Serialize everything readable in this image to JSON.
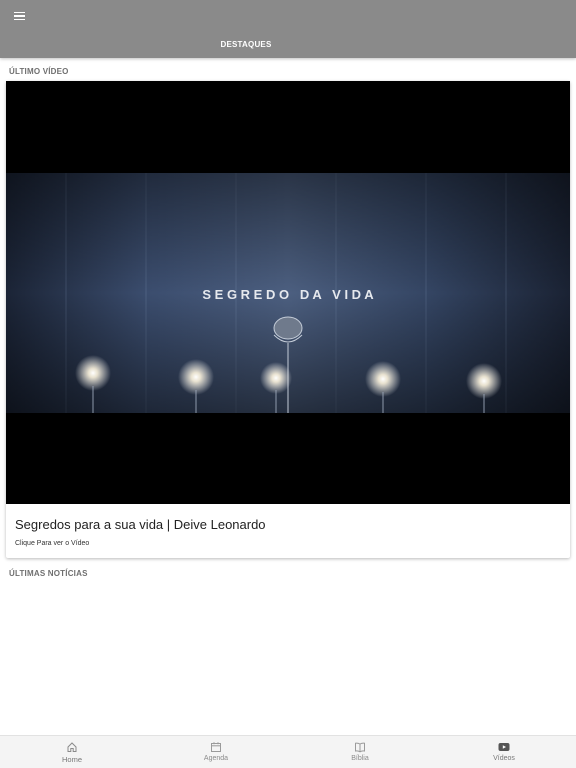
{
  "header": {
    "title": "DESTAQUES",
    "menu_icon": "hamburger-menu-icon",
    "background": "#8a8a8a"
  },
  "latest_video": {
    "section_label": "ÚLTIMO VÍDEO",
    "thumbnail_text": "S E G R E D O   D A   V I D A",
    "title": "Segredos para a sua vida | Deive Leonardo",
    "subtitle": "Clique Para ver o Vídeo"
  },
  "news": {
    "section_label": "ÚLTIMAS NOTÍCIAS"
  },
  "bottom_nav": {
    "items": [
      {
        "label": "Home",
        "icon": "home-icon"
      },
      {
        "label": "Agenda",
        "icon": "calendar-icon"
      },
      {
        "label": "Bíblia",
        "icon": "book-icon"
      },
      {
        "label": "Vídeos",
        "icon": "youtube-play-icon"
      }
    ]
  }
}
